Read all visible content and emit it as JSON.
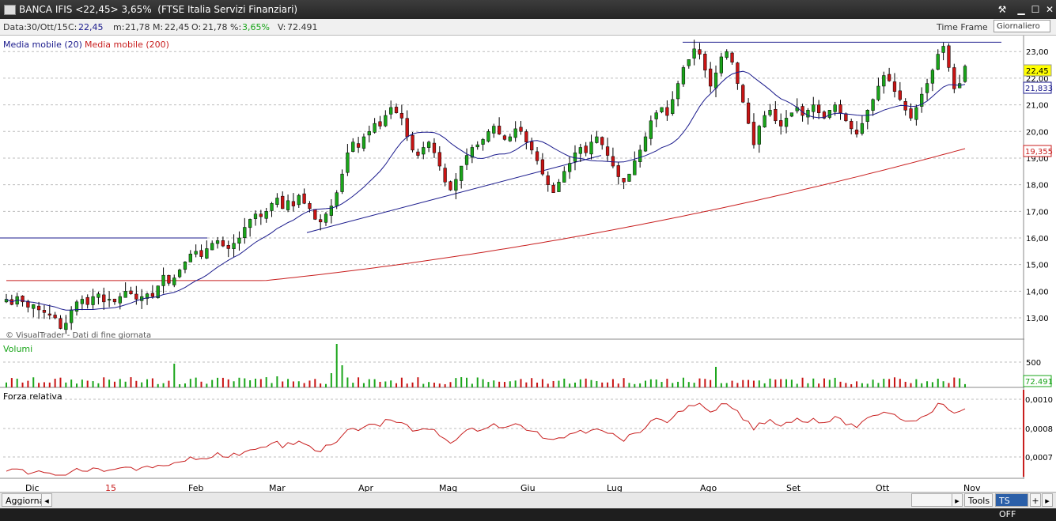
{
  "window": {
    "title": "BANCA IFIS <22,45> 3,65%  (FTSE Italia Servizi Finanziari)"
  },
  "info": {
    "data_label": "Data:",
    "data_value": "30/Ott/15",
    "close_label": "C:",
    "close_value": "22,45",
    "min_label": "m:",
    "min_value": "21,78",
    "max_label": "M:",
    "max_value": "22,45",
    "open_label": "O:",
    "open_value": "21,78",
    "pct_label": "%:",
    "pct_value": "3,65%",
    "vol_label": "V:",
    "vol_value": "72.491",
    "timeframe_label": "Time Frame",
    "timeframe_value": "Giornaliero"
  },
  "legend": {
    "ma20": "Media mobile (20)",
    "ma200": "Media mobile (200)",
    "credit": "© VisualTrader - Dati di fine giornata"
  },
  "panels": {
    "volume_title": "Volumi",
    "rs_title": "Forza relativa"
  },
  "status": {
    "update_label": "Aggiorna",
    "tools_label": "Tools",
    "ts_label": "TS OFF",
    "plus_label": "+"
  },
  "colors": {
    "up": "#1aa51a",
    "down": "#c81414",
    "ma20": "#1a1a8c",
    "ma200": "#c81e1e",
    "grid": "#bdbdbd",
    "price_badge": "#ffff00",
    "ma200_badge": "#c81e1e"
  },
  "chart_data": {
    "type": "candlestick",
    "title": "BANCA IFIS",
    "y_ticks": [
      "13,00",
      "14,00",
      "15,00",
      "16,00",
      "17,00",
      "18,00",
      "19,00",
      "20,00",
      "21,00",
      "22,00",
      "23,00"
    ],
    "ylim": [
      12.2,
      23.6
    ],
    "x_labels": [
      "Dic",
      "15",
      "Feb",
      "Mar",
      "Apr",
      "Mag",
      "Giu",
      "Lug",
      "Ago",
      "Set",
      "Ott",
      "Nov"
    ],
    "last": {
      "price": "22,45",
      "ma20": "21,833",
      "ma200": "19,355",
      "volume": "72.491"
    },
    "volume_ticks": [
      "500"
    ],
    "rs_ticks": [
      "0,0010",
      "0,0008",
      "0,0007"
    ],
    "closes": [
      13.7,
      13.5,
      13.8,
      13.6,
      13.4,
      13.5,
      13.3,
      13.2,
      13.1,
      13.0,
      12.6,
      12.8,
      13.3,
      13.6,
      13.7,
      13.5,
      13.8,
      13.9,
      13.6,
      13.7,
      13.6,
      13.8,
      14.0,
      13.9,
      13.7,
      13.8,
      13.9,
      13.8,
      14.2,
      14.6,
      14.3,
      14.5,
      14.8,
      15.1,
      15.4,
      15.5,
      15.3,
      15.6,
      15.8,
      15.9,
      15.7,
      15.6,
      15.8,
      16.0,
      16.4,
      16.7,
      16.9,
      16.8,
      17.0,
      17.3,
      17.5,
      17.1,
      17.4,
      17.2,
      17.6,
      17.3,
      17.1,
      16.7,
      16.6,
      16.9,
      17.2,
      17.7,
      18.4,
      19.2,
      19.6,
      19.4,
      19.8,
      20.0,
      20.3,
      20.2,
      20.6,
      20.9,
      20.7,
      20.5,
      19.8,
      19.3,
      19.1,
      19.4,
      19.6,
      19.2,
      18.7,
      18.1,
      17.8,
      18.2,
      18.7,
      19.1,
      19.4,
      19.5,
      19.7,
      20.0,
      20.2,
      19.9,
      19.7,
      19.8,
      20.1,
      20.0,
      19.6,
      19.3,
      18.9,
      18.4,
      18.0,
      17.7,
      18.1,
      18.5,
      18.8,
      19.2,
      19.4,
      19.2,
      19.6,
      19.8,
      19.5,
      19.1,
      18.7,
      18.3,
      18.1,
      18.4,
      18.9,
      19.3,
      19.8,
      20.4,
      20.7,
      20.9,
      20.6,
      21.2,
      21.8,
      22.4,
      22.7,
      23.1,
      22.9,
      22.3,
      21.7,
      22.2,
      22.8,
      23.0,
      22.6,
      21.8,
      21.1,
      20.3,
      19.5,
      20.2,
      20.6,
      20.8,
      20.4,
      20.2,
      20.5,
      20.7,
      20.9,
      20.6,
      20.8,
      21.0,
      20.7,
      20.5,
      20.8,
      21.0,
      20.7,
      20.4,
      20.1,
      19.9,
      20.3,
      20.8,
      21.2,
      21.7,
      22.1,
      21.9,
      21.5,
      21.2,
      20.8,
      20.5,
      20.9,
      21.4,
      21.8,
      22.3,
      22.9,
      23.2,
      22.4,
      21.6,
      21.8,
      22.45
    ],
    "ma20_end": 21.833,
    "ma200_end": 19.355
  }
}
